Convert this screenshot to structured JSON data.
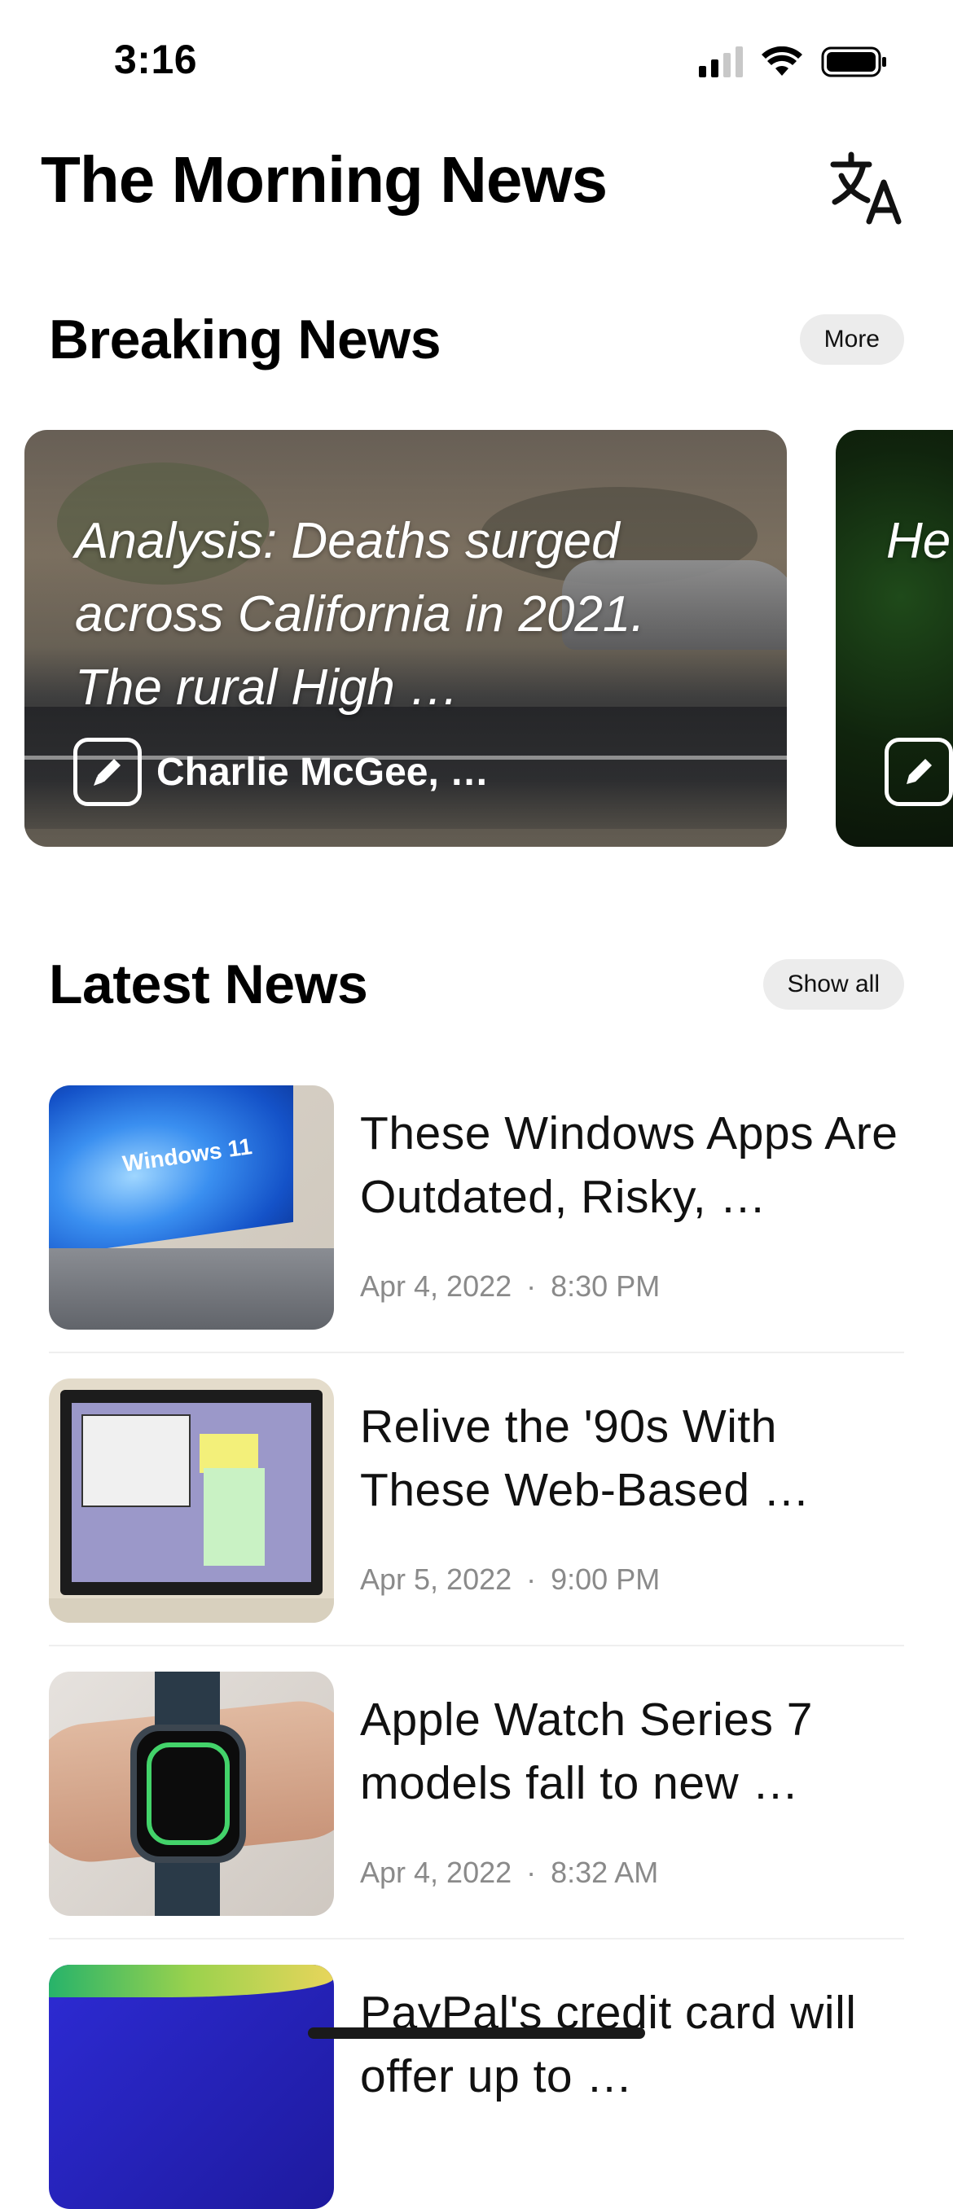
{
  "status_bar": {
    "time": "3:16"
  },
  "header": {
    "title": "The Morning News",
    "translate_icon": "translate-icon"
  },
  "breaking": {
    "title": "Breaking News",
    "more_label": "More",
    "cards": [
      {
        "headline": "Analysis: Deaths surged across California in 2021. The rural High …",
        "author": "Charlie McGee, …"
      },
      {
        "headline": "He… m… Mc…",
        "author": ""
      }
    ]
  },
  "latest": {
    "title": "Latest News",
    "show_all_label": "Show all",
    "items": [
      {
        "title": "These Windows Apps Are Outdated, Risky, …",
        "date": "Apr 4, 2022",
        "separator": "·",
        "time": "8:30 PM",
        "thumb_label": "Windows 11"
      },
      {
        "title": "Relive the '90s With These Web-Based …",
        "date": "Apr 5, 2022",
        "separator": "·",
        "time": "9:00 PM"
      },
      {
        "title": "Apple Watch Series 7 models fall to new …",
        "date": "Apr 4, 2022",
        "separator": "·",
        "time": "8:32 AM"
      },
      {
        "title": "PayPal's credit card will offer up to …"
      }
    ]
  }
}
